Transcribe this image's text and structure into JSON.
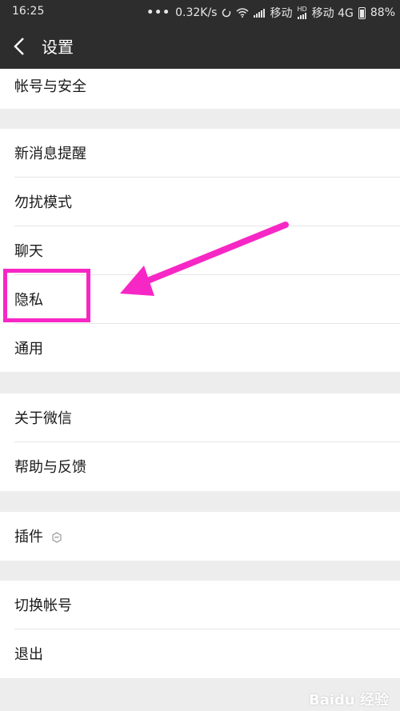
{
  "status_bar": {
    "time": "16:25",
    "dots": "•••",
    "network_speed": "0.32K/s",
    "carrier1": "移动",
    "hd": "HD",
    "carrier2": "移动 4G",
    "battery": "88%"
  },
  "nav": {
    "title": "设置"
  },
  "groups": {
    "account": {
      "item0": "帐号与安全"
    },
    "general": {
      "item0": "新消息提醒",
      "item1": "勿扰模式",
      "item2": "聊天",
      "item3": "隐私",
      "item4": "通用"
    },
    "about": {
      "item0": "关于微信",
      "item1": "帮助与反馈"
    },
    "plugins": {
      "item0": "插件"
    },
    "session": {
      "item0": "切换帐号",
      "item1": "退出"
    }
  },
  "annotation": {
    "color": "#f727c5"
  },
  "watermark": "Baidu 经验"
}
